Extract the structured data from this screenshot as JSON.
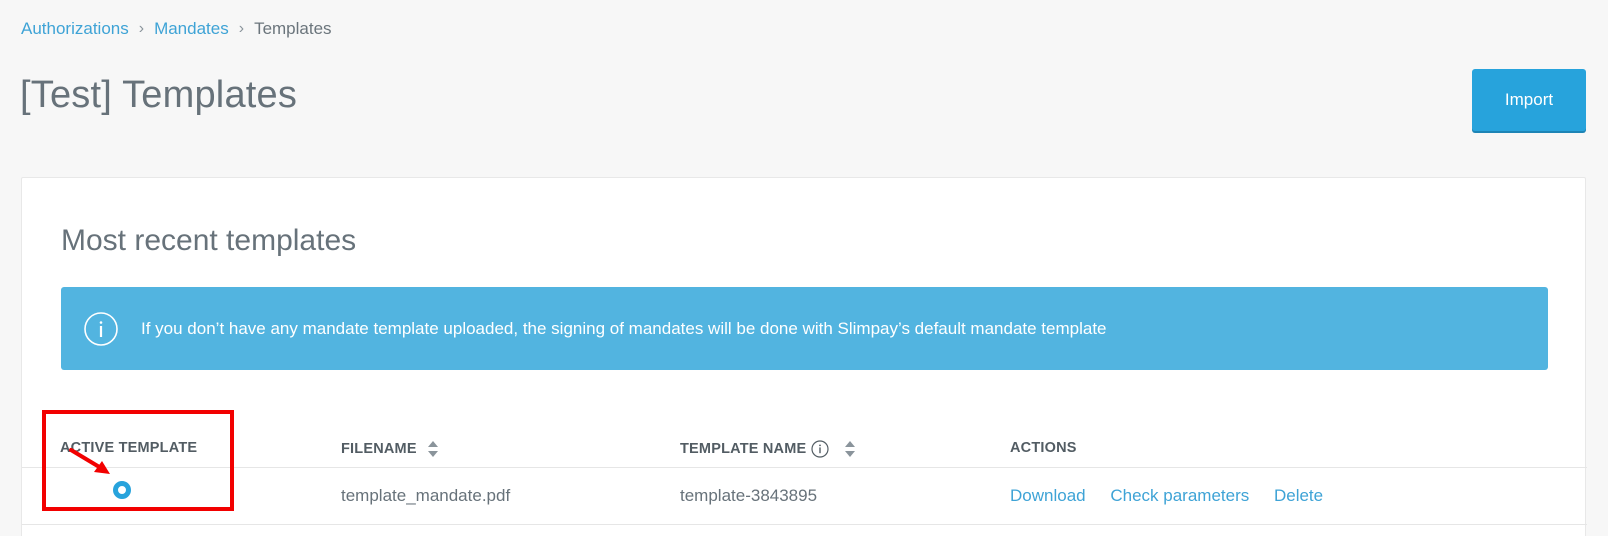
{
  "breadcrumb": {
    "items": [
      {
        "label": "Authorizations"
      },
      {
        "label": "Mandates"
      },
      {
        "label": "Templates"
      }
    ],
    "separator": "›"
  },
  "page": {
    "title": "[Test] Templates",
    "import_label": "Import"
  },
  "card": {
    "title": "Most recent templates",
    "info_banner": "If you don’t have any mandate template uploaded, the signing of mandates will be done with Slimpay’s default mandate template"
  },
  "table": {
    "columns": [
      {
        "label": "ACTIVE TEMPLATE"
      },
      {
        "label": "FILENAME"
      },
      {
        "label": "TEMPLATE NAME"
      },
      {
        "label": "ACTIONS"
      }
    ],
    "rows": [
      {
        "active": true,
        "filename": "template_mandate.pdf",
        "template_name": "template-3843895",
        "actions": [
          "Download",
          "Check parameters",
          "Delete"
        ]
      }
    ]
  },
  "colors": {
    "accent": "#27a3dc",
    "link": "#3ea3d6",
    "banner": "#52b4e0",
    "annotation": "#f20000"
  },
  "icons": [
    "info-icon",
    "sort-icon",
    "info-small-icon",
    "radio-selected-icon",
    "annotation-arrow-icon"
  ]
}
